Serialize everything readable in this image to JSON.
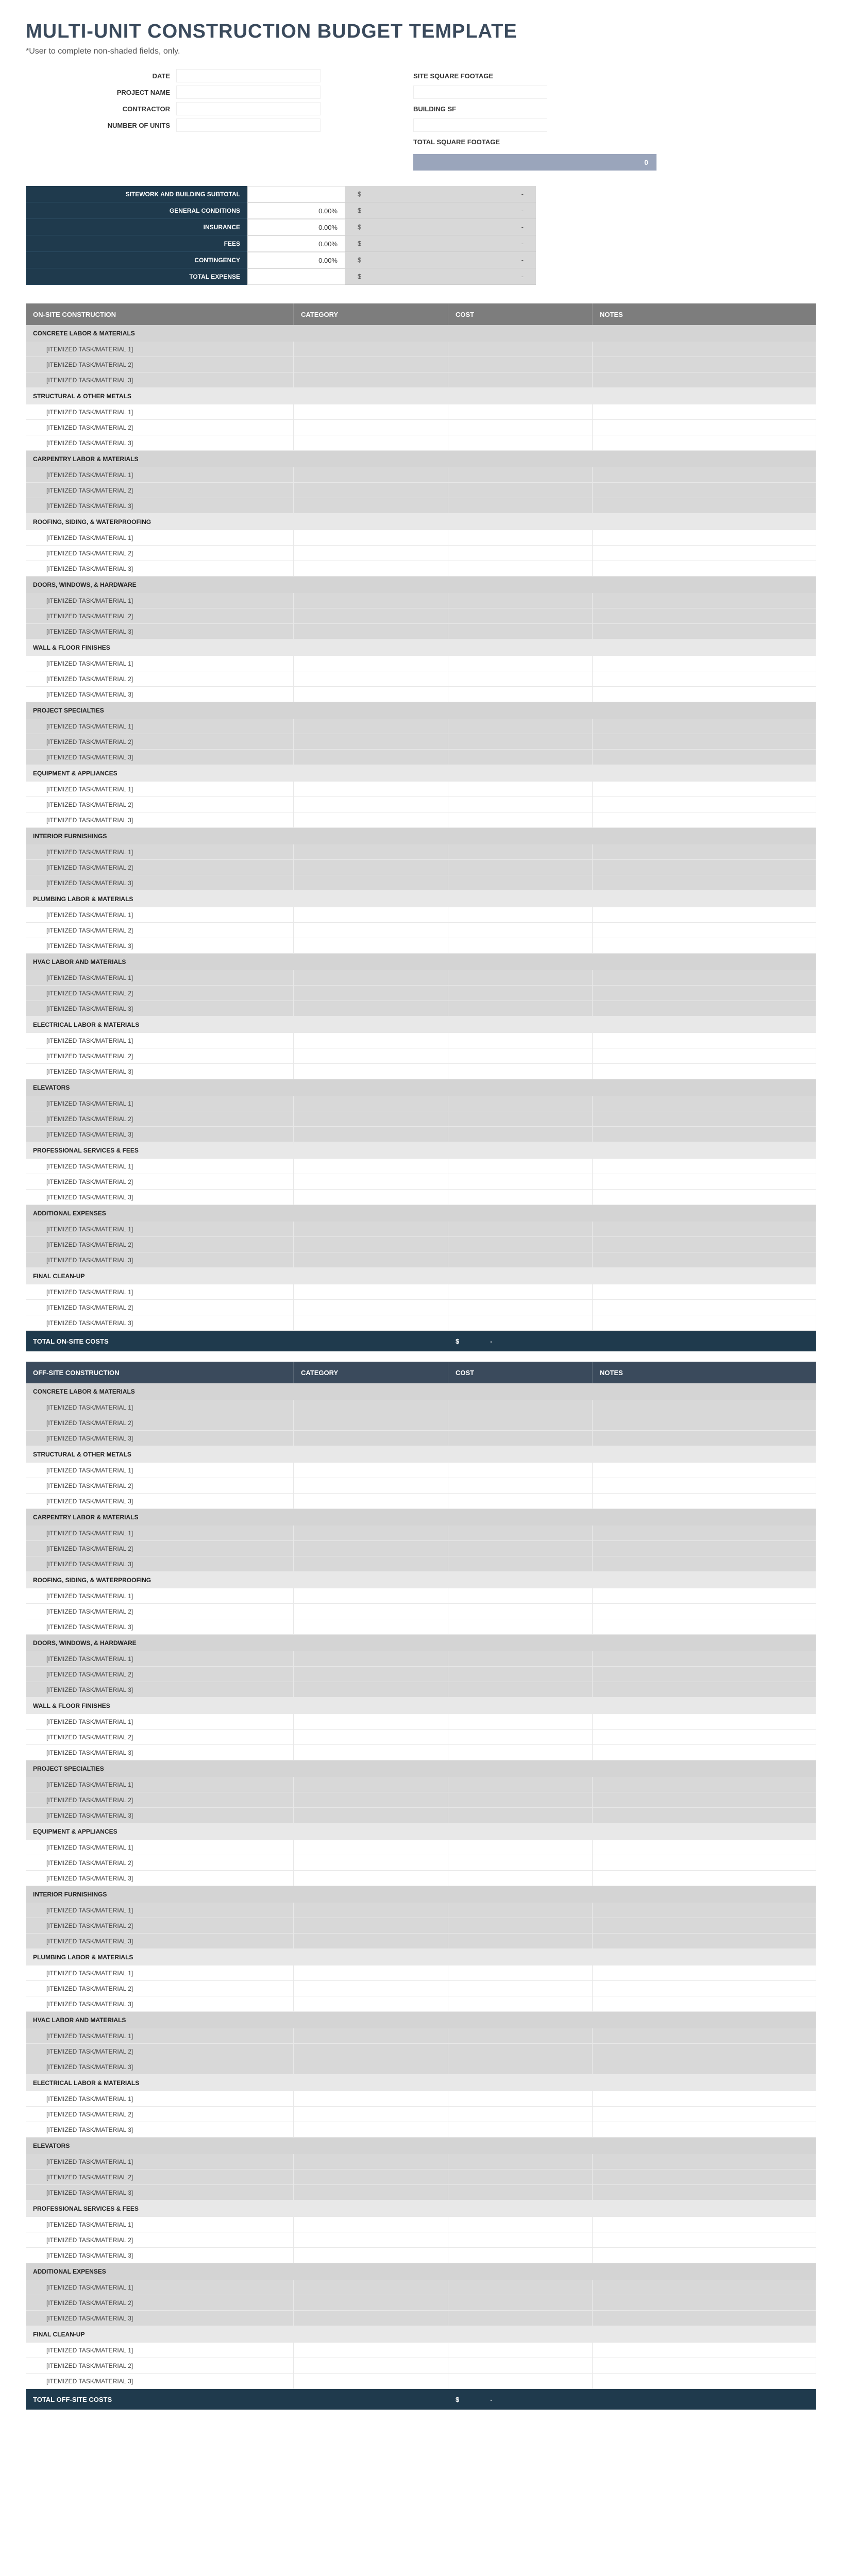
{
  "title": "MULTI-UNIT CONSTRUCTION BUDGET TEMPLATE",
  "note": "*User to complete non-shaded fields, only.",
  "meta": {
    "date": "DATE",
    "project": "PROJECT NAME",
    "contractor": "CONTRACTOR",
    "units": "NUMBER OF UNITS"
  },
  "sf": {
    "site": "SITE SQUARE FOOTAGE",
    "building": "BUILDING SF",
    "total": "TOTAL SQUARE FOOTAGE",
    "totalVal": "0"
  },
  "summary": [
    {
      "label": "SITEWORK AND BUILDING SUBTOTAL",
      "pct": "",
      "sym": "$",
      "amt": "-"
    },
    {
      "label": "GENERAL CONDITIONS",
      "pct": "0.00%",
      "sym": "$",
      "amt": "-"
    },
    {
      "label": "INSURANCE",
      "pct": "0.00%",
      "sym": "$",
      "amt": "-"
    },
    {
      "label": "FEES",
      "pct": "0.00%",
      "sym": "$",
      "amt": "-"
    },
    {
      "label": "CONTINGENCY",
      "pct": "0.00%",
      "sym": "$",
      "amt": "-"
    },
    {
      "label": "TOTAL EXPENSE",
      "pct": "",
      "sym": "$",
      "amt": "-"
    }
  ],
  "cols": {
    "c1a": "ON-SITE CONSTRUCTION",
    "c1b": "OFF-SITE CONSTRUCTION",
    "c2": "CATEGORY",
    "c3": "COST",
    "c4": "NOTES"
  },
  "placeholder": "[ITEMIZED TASK/MATERIAL",
  "sections": [
    "CONCRETE LABOR & MATERIALS",
    "STRUCTURAL & OTHER METALS",
    "CARPENTRY LABOR & MATERIALS",
    "ROOFING, SIDING, & WATERPROOFING",
    "DOORS, WINDOWS, & HARDWARE",
    "WALL & FLOOR FINISHES",
    "PROJECT SPECIALTIES",
    "EQUIPMENT & APPLIANCES",
    "INTERIOR FURNISHINGS",
    "PLUMBING LABOR & MATERIALS",
    "HVAC LABOR AND MATERIALS",
    "ELECTRICAL LABOR & MATERIALS",
    "ELEVATORS",
    "PROFESSIONAL SERVICES & FEES",
    "ADDITIONAL EXPENSES",
    "FINAL CLEAN-UP"
  ],
  "totals": {
    "onsite": "TOTAL ON-SITE COSTS",
    "offsite": "TOTAL OFF-SITE COSTS",
    "sym": "$",
    "amt": "-"
  }
}
